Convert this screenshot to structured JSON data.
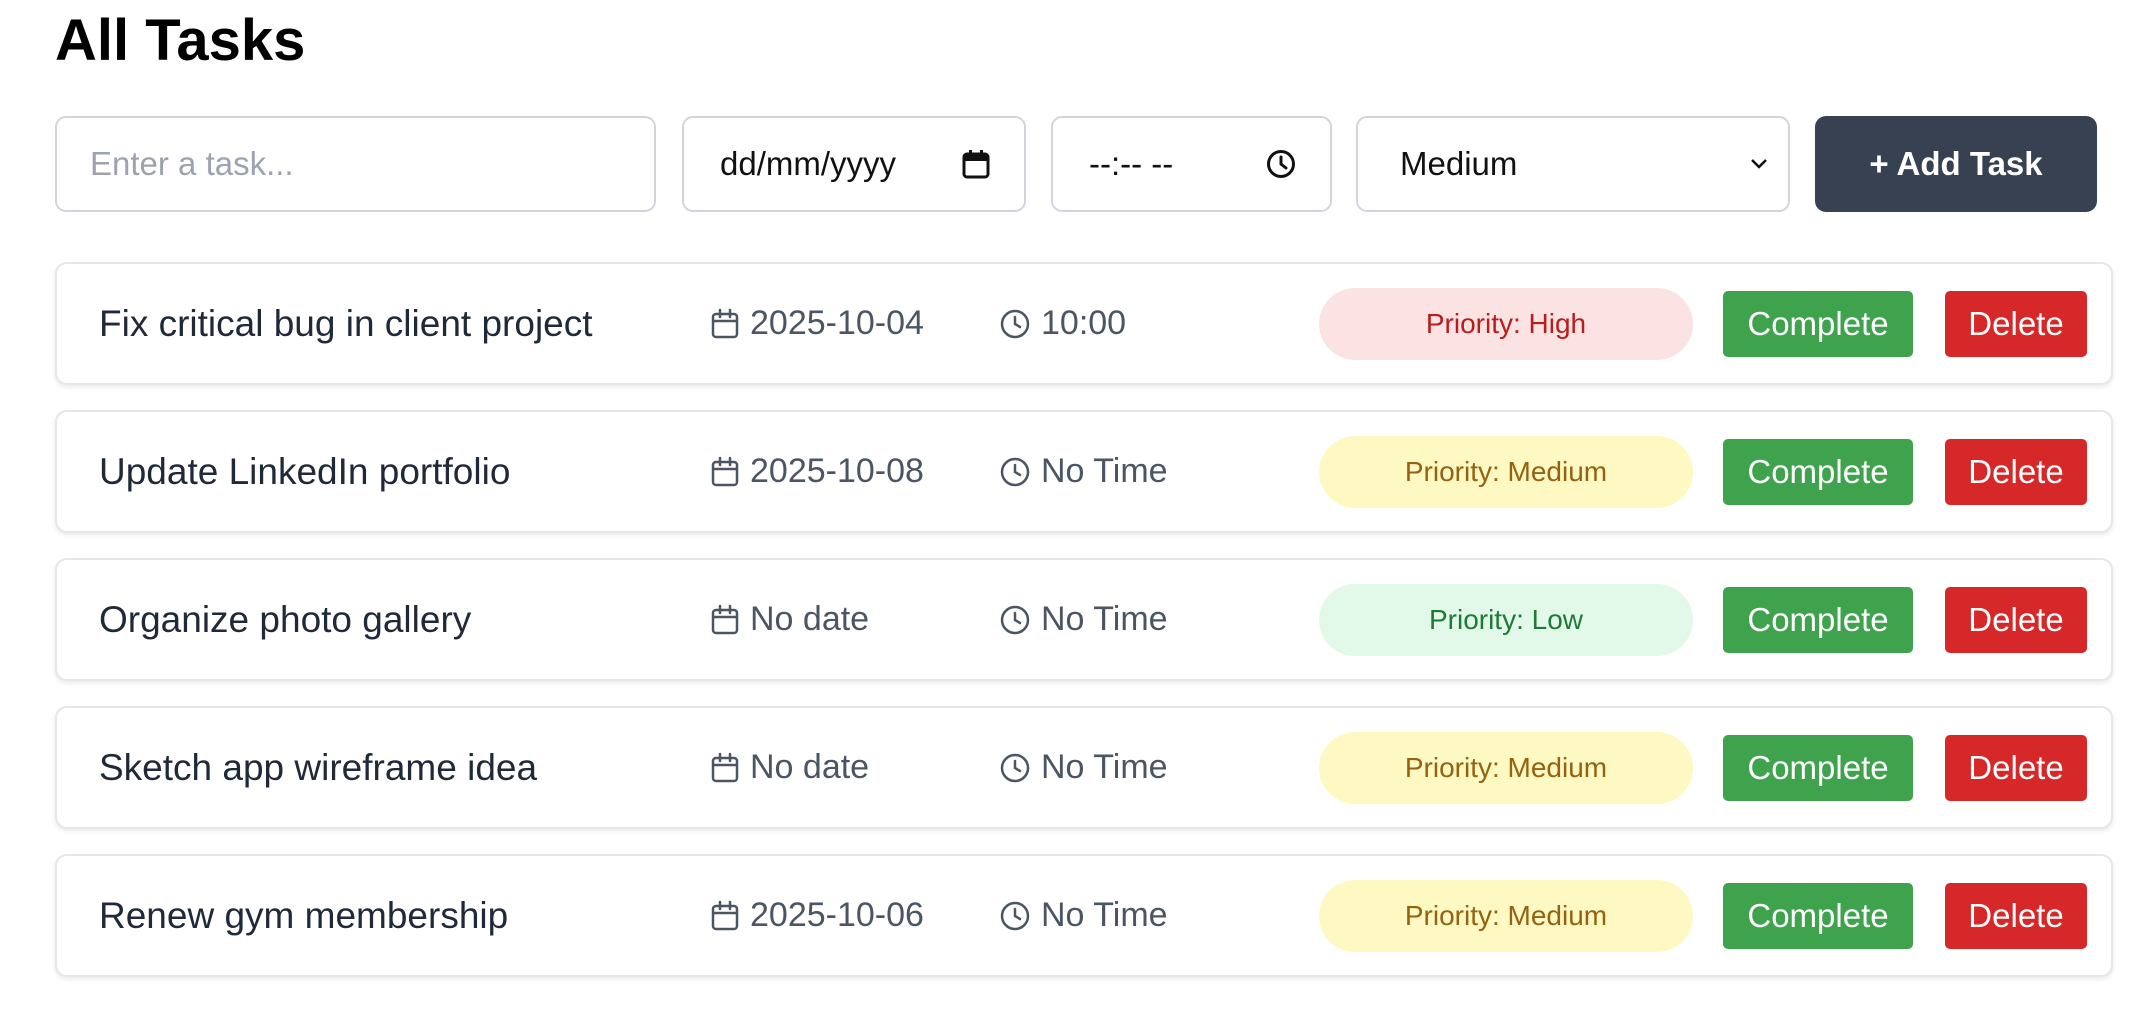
{
  "page": {
    "title": "All Tasks"
  },
  "form": {
    "task_placeholder": "Enter a task...",
    "date_placeholder": "dd/mm/yyyy",
    "time_placeholder": "--:-- --",
    "priority_selected": "Medium",
    "add_button_label": "+ Add Task"
  },
  "colors": {
    "add_button": "#374151",
    "complete_button": "#3fa34d",
    "delete_button": "#d62828",
    "priority_high_bg": "#fbe3e3",
    "priority_medium_bg": "#fef9c3",
    "priority_low_bg": "#e2f8e8"
  },
  "tasks": [
    {
      "name": "Fix critical bug in client project",
      "date": "2025-10-04",
      "time": "10:00",
      "priority_label": "Priority: High",
      "priority_level": "high",
      "complete_label": "Complete",
      "delete_label": "Delete"
    },
    {
      "name": "Update LinkedIn portfolio",
      "date": "2025-10-08",
      "time": "No Time",
      "priority_label": "Priority: Medium",
      "priority_level": "medium",
      "complete_label": "Complete",
      "delete_label": "Delete"
    },
    {
      "name": "Organize photo gallery",
      "date": "No date",
      "time": "No Time",
      "priority_label": "Priority: Low",
      "priority_level": "low",
      "complete_label": "Complete",
      "delete_label": "Delete"
    },
    {
      "name": "Sketch app wireframe idea",
      "date": "No date",
      "time": "No Time",
      "priority_label": "Priority: Medium",
      "priority_level": "medium",
      "complete_label": "Complete",
      "delete_label": "Delete"
    },
    {
      "name": "Renew gym membership",
      "date": "2025-10-06",
      "time": "No Time",
      "priority_label": "Priority: Medium",
      "priority_level": "medium",
      "complete_label": "Complete",
      "delete_label": "Delete"
    }
  ]
}
